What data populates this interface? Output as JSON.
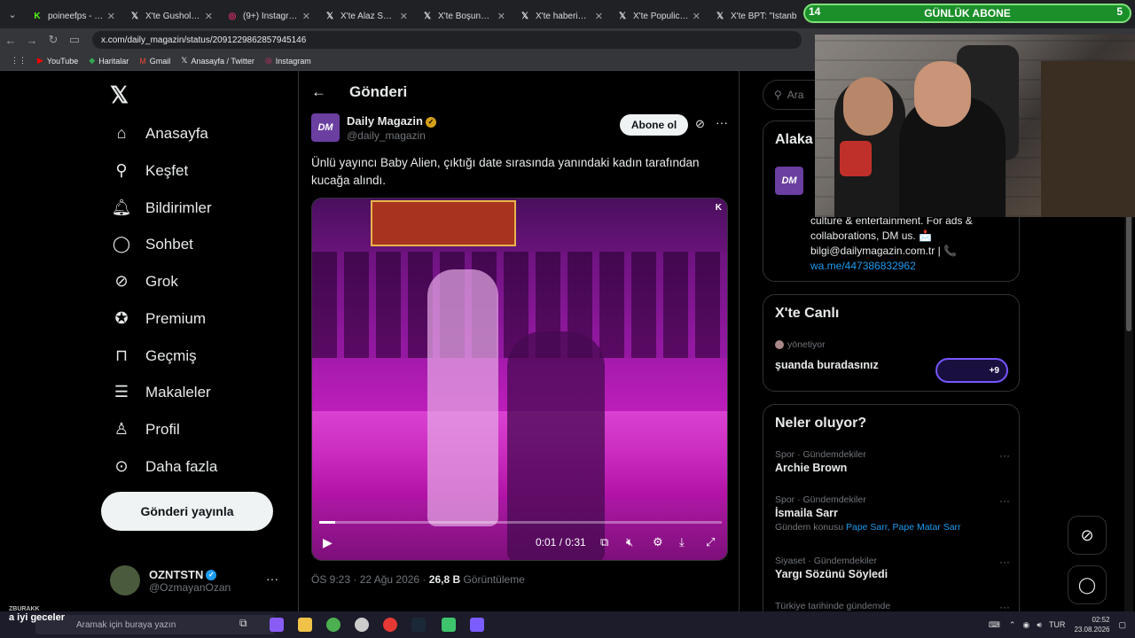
{
  "browser": {
    "tabs": [
      {
        "label": "poineefps - Watch",
        "icon": "kick-icon",
        "color": "#53fc18"
      },
      {
        "label": "X'te Gusholder H",
        "icon": "x-icon",
        "color": "#ffffff"
      },
      {
        "label": "(9+) Instagram",
        "icon": "instagram-icon",
        "color": "#e1306c"
      },
      {
        "label": "X'te Alaz Sümer",
        "icon": "x-icon",
        "color": "#ffffff"
      },
      {
        "label": "X'te Boşuna Tıkla",
        "icon": "x-icon",
        "color": "#ffffff"
      },
      {
        "label": "X'te haberia: \"Tür",
        "icon": "x-icon",
        "color": "#ffffff"
      },
      {
        "label": "X'te Populicc: \"Ta",
        "icon": "x-icon",
        "color": "#ffffff"
      },
      {
        "label": "X'te BPT: \"İstanb",
        "icon": "x-icon",
        "color": "#ffffff"
      }
    ],
    "url": "x.com/daily_magazin/status/2091229862857945146",
    "bookmarks": [
      {
        "label": "YouTube",
        "icon": "youtube-icon"
      },
      {
        "label": "Haritalar",
        "icon": "maps-icon"
      },
      {
        "label": "Gmail",
        "icon": "gmail-icon"
      },
      {
        "label": "Anasayfa / Twitter",
        "icon": "x-icon"
      },
      {
        "label": "Instagram",
        "icon": "instagram-icon"
      }
    ]
  },
  "nav": {
    "items": [
      {
        "label": "Anasayfa",
        "icon": "home-icon"
      },
      {
        "label": "Keşfet",
        "icon": "search-icon"
      },
      {
        "label": "Bildirimler",
        "icon": "bell-icon"
      },
      {
        "label": "Sohbet",
        "icon": "chat-icon"
      },
      {
        "label": "Grok",
        "icon": "grok-icon"
      },
      {
        "label": "Premium",
        "icon": "premium-icon"
      },
      {
        "label": "Geçmiş",
        "icon": "bookmark-icon"
      },
      {
        "label": "Makaleler",
        "icon": "article-icon"
      },
      {
        "label": "Profil",
        "icon": "person-icon"
      },
      {
        "label": "Daha fazla",
        "icon": "more-circle-icon"
      }
    ],
    "post_button": "Gönderi yayınla",
    "profile": {
      "name": "OZNTSTN",
      "handle": "@OzmayanOzan"
    }
  },
  "post": {
    "header": "Gönderi",
    "author_name": "Daily Magazin",
    "author_handle": "@daily_magazin",
    "avatar_text": "DM",
    "subscribe": "Abone ol",
    "text": "Ünlü yayıncı Baby Alien, çıktığı date sırasında yanındaki kadın tarafından kucağa alındı.",
    "video": {
      "time": "0:01 / 0:31",
      "progress": 0.04,
      "watermark": "DM"
    },
    "time": "ÖS 9:23 · 22 Ağu 2026 · ",
    "views": "26,8 B",
    "views_label": " Görüntüleme"
  },
  "sidebar": {
    "search_placeholder": "Ara",
    "related_title": "Alaka",
    "related_bio": "culture & entertainment. For ads & collaborations, DM us. 📩 bilgi@dailymagazin.com.tr | 📞",
    "related_link": "wa.me/447386832962",
    "live_title": "X'te Canlı",
    "live_host": "yönetiyor",
    "live_name": "şuanda buradasınız",
    "live_count": "+9",
    "trends_title": "Neler oluyor?",
    "trends": [
      {
        "category": "Spor · Gündemdekiler",
        "name": "Archie Brown",
        "sub": ""
      },
      {
        "category": "Spor · Gündemdekiler",
        "name": "İsmaila Sarr",
        "sub": "Gündem konusu",
        "links": "Pape Sarr, Pape Matar Sarr"
      },
      {
        "category": "Siyaset · Gündemdekiler",
        "name": "Yargı Sözünü Söyledi",
        "sub": ""
      },
      {
        "category": "Türkiye tarihinde gündemde",
        "name": "",
        "sub": ""
      }
    ]
  },
  "overlay": {
    "abone_label": "GÜNLÜK ABONE",
    "abone_left": "14",
    "abone_right": "5",
    "chat_user": "ZBURAKK",
    "chat_msg": "a iyi geceler"
  },
  "taskbar": {
    "search": "Aramak için buraya yazın",
    "lang": "TUR",
    "time": "02:52",
    "date": "23.08.2026"
  }
}
